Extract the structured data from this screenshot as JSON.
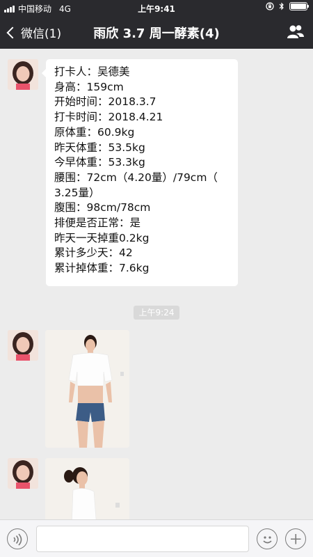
{
  "status_bar": {
    "carrier": "中国移动",
    "network": "4G",
    "time": "上午9:41",
    "battery_level": 1.0
  },
  "nav": {
    "back_label": "微信(1)",
    "title": "雨欣 3.7 周一酵素(4)",
    "members_icon": "group-icon"
  },
  "messages": [
    {
      "type": "text",
      "lines": [
        "打卡人：吴德美",
        "身高：159cm",
        "开始时间：2018.3.7",
        "打卡时间：2018.4.21",
        "原体重：60.9kg",
        "昨天体重：53.5kg",
        "今早体重：53.3kg",
        "腰围：72cm（4.20量）/79cm（",
        "3.25量）",
        "腹围：98cm/78cm",
        "排便是否正常：是",
        "昨天一天掉重0.2kg",
        "累计多少天：42",
        "累计掉体重：7.6kg"
      ]
    },
    {
      "type": "time",
      "label": "上午9:24"
    },
    {
      "type": "image",
      "content": "front-view-photo"
    },
    {
      "type": "image",
      "content": "side-view-photo"
    }
  ],
  "input_bar": {
    "voice_icon": "voice-icon",
    "text_value": "",
    "emoji_icon": "emoji-icon",
    "plus_icon": "plus-icon"
  },
  "colors": {
    "nav_background": "#2a2a2e",
    "chat_background": "#ececec",
    "bubble_background": "#ffffff",
    "time_pill": "#d9d9d9"
  }
}
